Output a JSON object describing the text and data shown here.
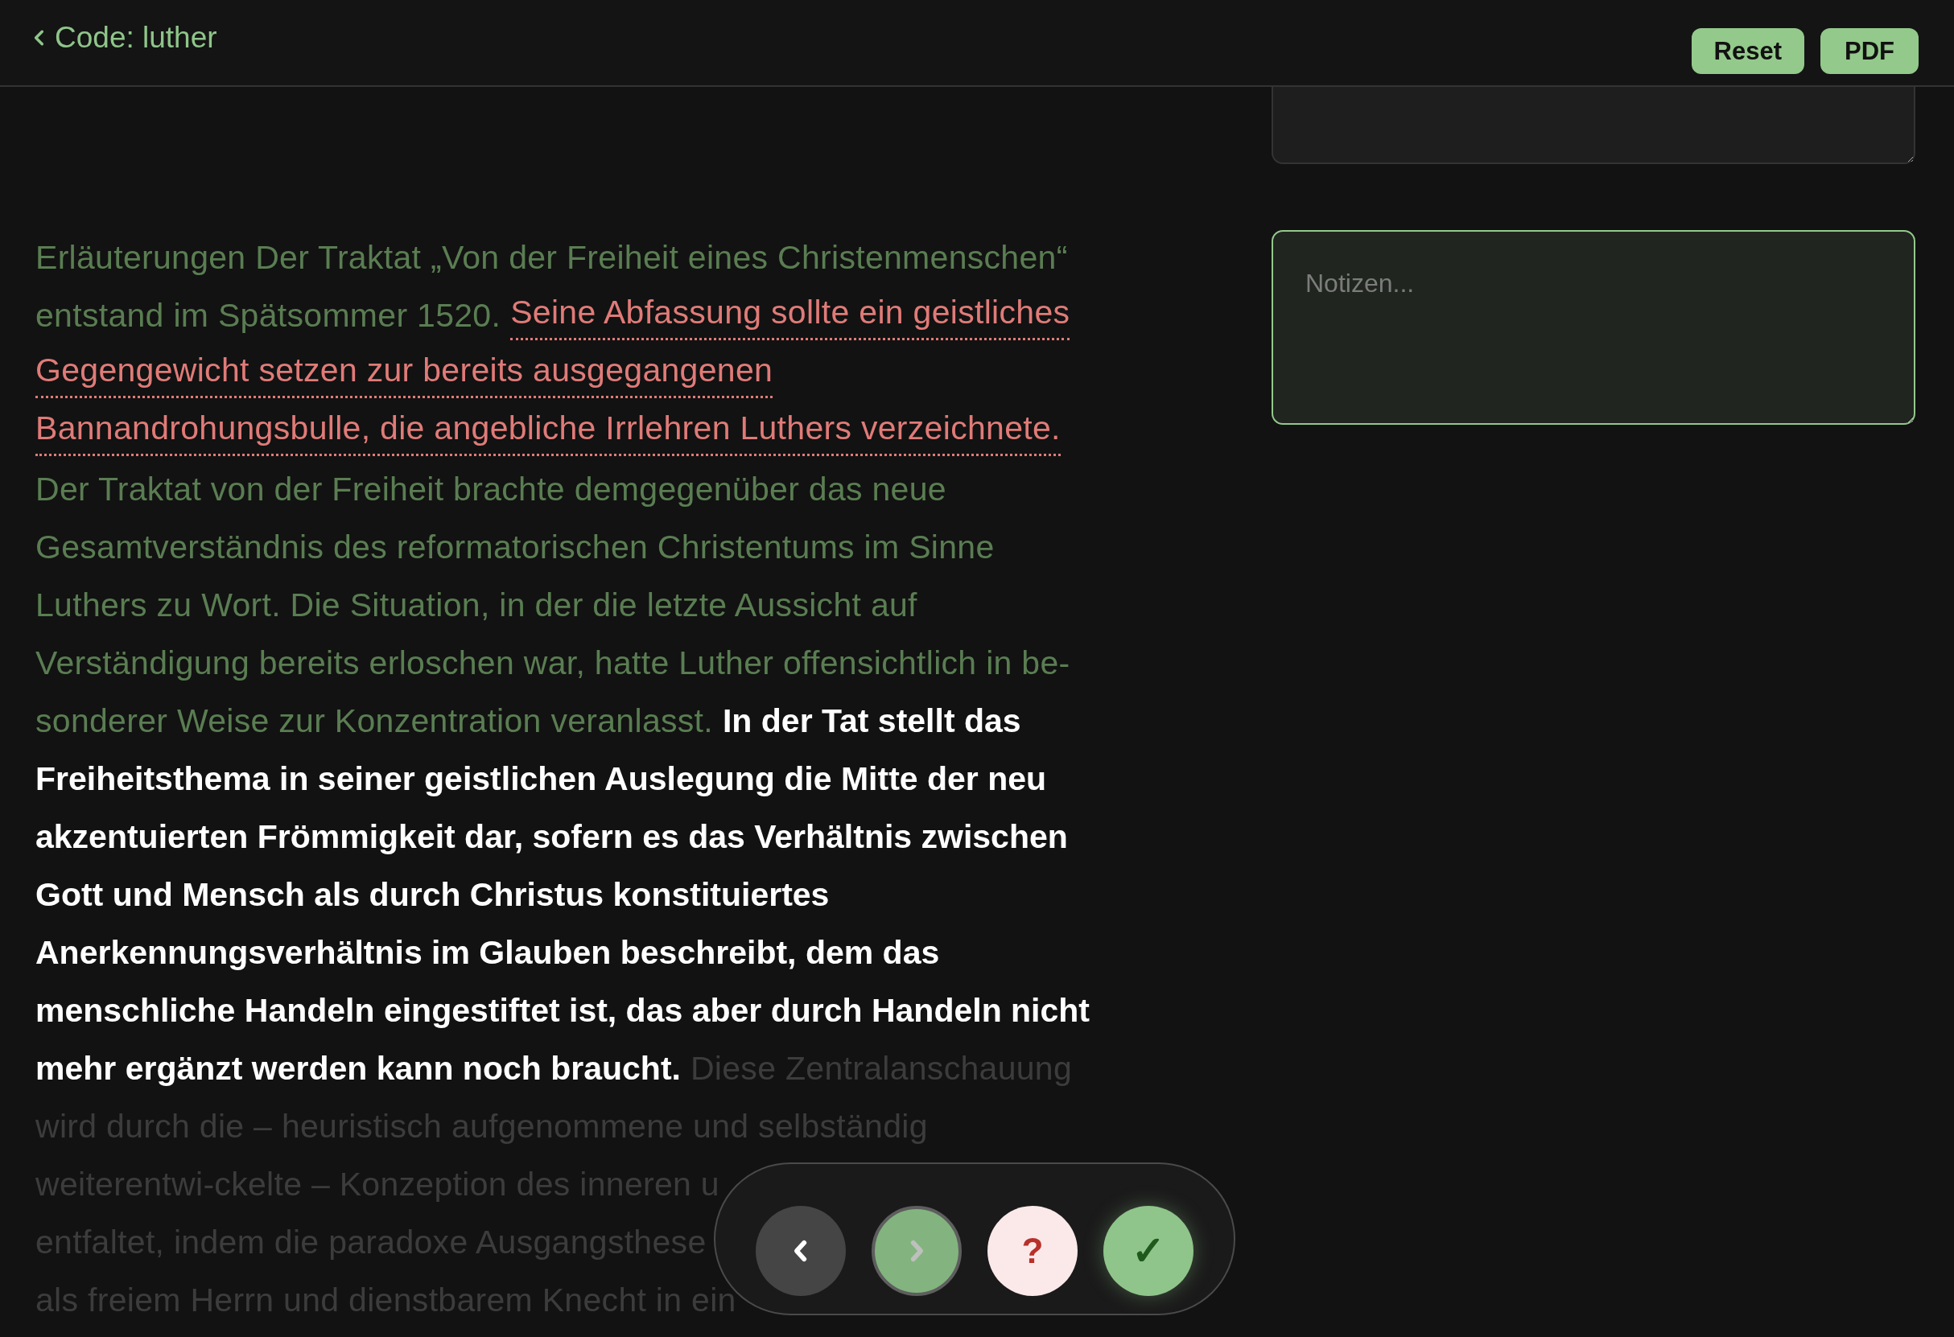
{
  "header": {
    "back_label": "Code: luther",
    "buttons": [
      "Reset",
      "PDF"
    ]
  },
  "text_lines": [
    [
      {
        "kind": "read",
        "text": "Erläuterungen Der Traktat „Von der Freiheit eines Christenmenschen“"
      }
    ],
    [
      {
        "kind": "read",
        "text": "entstand im Spätsommer 1520."
      },
      {
        "kind": "flagged",
        "text": "Seine Abfassung sollte ein geistliches"
      }
    ],
    [
      {
        "kind": "flagged",
        "text": "Gegengewicht setzen zur bereits ausgegangenen"
      }
    ],
    [
      {
        "kind": "flagged",
        "text": "Bannandrohungsbulle, die angebliche Irrlehren Luthers verzeichnete."
      }
    ],
    [
      {
        "kind": "read",
        "text": "Der Traktat von der Freiheit brachte demgegenüber das neue"
      }
    ],
    [
      {
        "kind": "read",
        "text": "Gesamtverständnis des reformatorischen Christentums im Sinne"
      }
    ],
    [
      {
        "kind": "read",
        "text": "Luthers zu Wort. Die Situation, in der die letzte Aussicht auf"
      }
    ],
    [
      {
        "kind": "read",
        "text": "Verständigung bereits erloschen war, hatte Luther offensichtlich in be-"
      }
    ],
    [
      {
        "kind": "read",
        "text": "sonderer Weise zur Konzentration veranlasst."
      },
      {
        "kind": "current",
        "text": "In der Tat stellt das"
      }
    ],
    [
      {
        "kind": "current",
        "text": "Freiheitsthema in seiner geistlichen Auslegung die Mitte der neu"
      }
    ],
    [
      {
        "kind": "current",
        "text": "akzentuierten Frömmigkeit dar, sofern es das Verhältnis zwischen"
      }
    ],
    [
      {
        "kind": "current",
        "text": "Gott und Mensch als durch Christus konstituiertes"
      }
    ],
    [
      {
        "kind": "current",
        "text": "Anerkennungsverhältnis im Glauben beschreibt, dem das"
      }
    ],
    [
      {
        "kind": "current",
        "text": "menschliche Handeln eingestiftet ist, das aber durch Handeln nicht"
      }
    ],
    [
      {
        "kind": "current",
        "text": "mehr ergänzt werden kann noch braucht."
      },
      {
        "kind": "upcoming",
        "text": "Diese Zentralanschauung"
      }
    ],
    [
      {
        "kind": "upcoming",
        "text": "wird durch die – heuristisch aufgenommene und selbständig"
      }
    ],
    [
      {
        "kind": "upcoming",
        "text": "weiterentwi-ckelte – Konzeption des inneren u"
      }
    ],
    [
      {
        "kind": "upcoming",
        "text": "entfaltet, indem die paradoxe Ausgangsthese"
      }
    ],
    [
      {
        "kind": "upcoming",
        "text": "als freiem Herrn und dienstbarem Knecht in ein"
      }
    ]
  ],
  "note_fields": [
    {
      "focused": false
    },
    {
      "placeholder": "Notizen...",
      "focused": true
    }
  ],
  "controls": [
    {
      "kind": "previous",
      "disabled": false
    },
    {
      "kind": "next",
      "disabled": true
    },
    {
      "kind": "help",
      "symbol": "?",
      "disabled": false
    },
    {
      "kind": "confirm",
      "symbol": "✓",
      "disabled": false
    }
  ]
}
